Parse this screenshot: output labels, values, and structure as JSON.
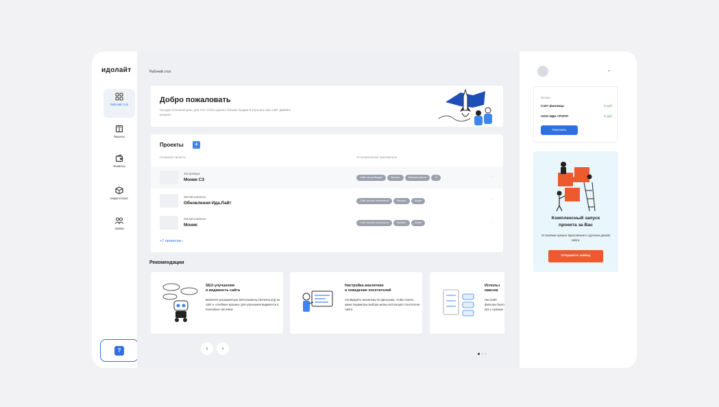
{
  "app": {
    "logo": "идолайт"
  },
  "sidebar": {
    "items": [
      {
        "label": "Рабочий стол",
        "icon": "dashboard-icon",
        "active": true
      },
      {
        "label": "Проекты",
        "icon": "projects-icon",
        "active": false
      },
      {
        "label": "Финансы",
        "icon": "wallet-icon",
        "active": false
      },
      {
        "label": "Маркетплейс",
        "icon": "marketplace-icon",
        "active": false
      },
      {
        "label": "Заявки",
        "icon": "requests-icon",
        "active": false
      }
    ],
    "chat_icon": "?"
  },
  "breadcrumb": "Рабочий стол",
  "welcome": {
    "title": "Добро пожаловать",
    "subtitle": "Сегодня отличный день, для того чтобы сделать больше продаж и улучшить ваш сайт. Давайте начнем!"
  },
  "projects": {
    "title": "Проекты",
    "add_label": "+",
    "col_name": "Название проекта",
    "col_apps": "Установленные приложения",
    "rows": [
      {
        "type": "Застройщик",
        "name": "Моник СЗ",
        "tags": [
          "Сайт застройщика",
          "Каталог",
          "Машино-места",
          "+3"
        ]
      },
      {
        "type": "Жилой комплекс",
        "name": "Обновления Ида.Лайт",
        "tags": [
          "Сайт жилого комплекса",
          "Каталог",
          "Акции"
        ]
      },
      {
        "type": "Жилой комплекс",
        "name": "Моник",
        "tags": [
          "Сайт жилого комплекса",
          "Каталог",
          "Акции"
        ]
      }
    ],
    "arrow": "→",
    "more": "+7 проектов  ›"
  },
  "recommendations": {
    "title": "Рекомендации",
    "cards": [
      {
        "title": "SEO-улучшения\nи видимость сайта",
        "desc": "Включите расширенную SEO-разметку (Schema.org) на сайт и «хлебные крошки» для улучшения видимости в поисковых системах."
      },
      {
        "title": "Настройка аналитики\nи поведение посетителей",
        "desc": "Активируйте аналитику по фильтрам, чтобы понять, какие параметры выбора жилья используют посетители сайта."
      },
      {
        "title": "Использ\nмаксим",
        "desc": "Настройт фильтры было про с нужным"
      }
    ],
    "prev": "‹",
    "next": "›"
  },
  "user": {
    "chevron": "⌄"
  },
  "balance": {
    "label": "Баланс",
    "rows": [
      {
        "name": "Счёт физлица",
        "value": "0 руб"
      },
      {
        "name": "ООО ИДА ГРУПП",
        "value": "0 руб"
      }
    ],
    "topup": "Пополнить"
  },
  "promo": {
    "title": "Комплексный запуск проекта за Вас",
    "desc": "Установим нужные приложения и сделаем дизайн сайта.",
    "button": "Отправить заявку"
  },
  "colors": {
    "accent": "#2f6fe0",
    "promo_button": "#ec5a2e",
    "positive": "#3fa648"
  }
}
